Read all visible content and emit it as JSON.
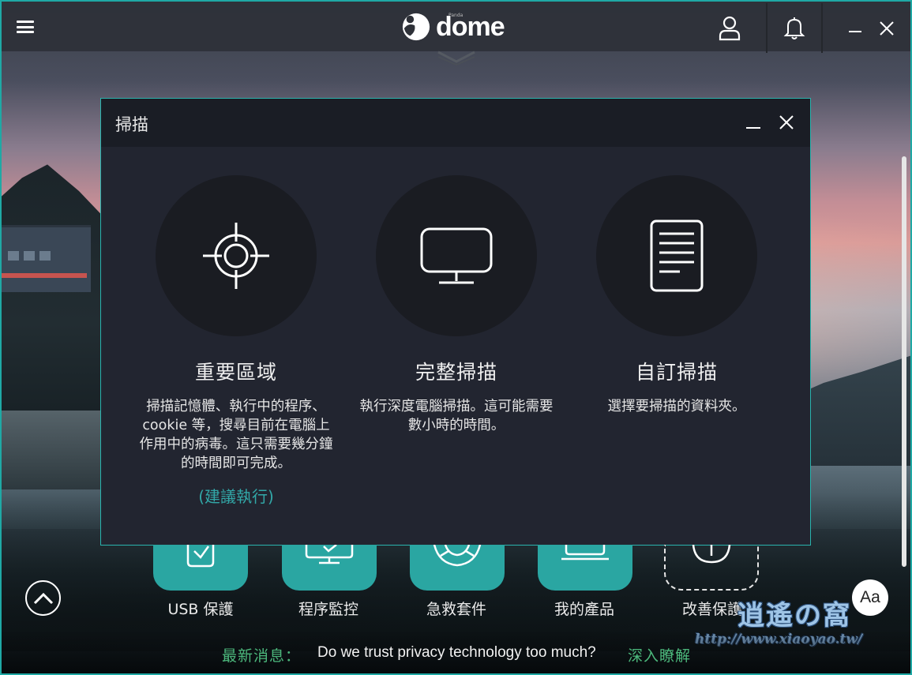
{
  "app": {
    "brand_small": "Panda",
    "brand": "dome",
    "accent_color": "#2aa6a2",
    "icons": {
      "menu": "hamburger-icon",
      "account": "user-icon",
      "notifications": "bell-icon",
      "minimize": "minimize-icon",
      "close": "close-icon"
    }
  },
  "dialog": {
    "title": "掃描",
    "options": [
      {
        "icon": "crosshair-icon",
        "title": "重要區域",
        "description": "掃描記憶體、執行中的程序、cookie 等，搜尋目前在電腦上作用中的病毒。這只需要幾分鐘的時間即可完成。",
        "recommend": "(建議執行)"
      },
      {
        "icon": "monitor-icon",
        "title": "完整掃描",
        "description": "執行深度電腦掃描。這可能需要數小時的時間。"
      },
      {
        "icon": "document-icon",
        "title": "自訂掃描",
        "description": "選擇要掃描的資料夾。"
      }
    ]
  },
  "tiles": [
    {
      "label": "USB 保護",
      "icon": "usb-shield-icon"
    },
    {
      "label": "程序監控",
      "icon": "process-monitor-icon"
    },
    {
      "label": "急救套件",
      "icon": "lifebuoy-icon"
    },
    {
      "label": "我的產品",
      "icon": "laptop-icon"
    },
    {
      "label": "改善保護",
      "icon": "plus-icon"
    }
  ],
  "font_button": "Aa",
  "news": {
    "label": "最新消息：",
    "headline": "Do we trust privacy technology too much?",
    "link": "深入瞭解"
  },
  "watermark": {
    "text": "逍遙の窩",
    "url": "http://www.xiaoyao.tw/"
  }
}
